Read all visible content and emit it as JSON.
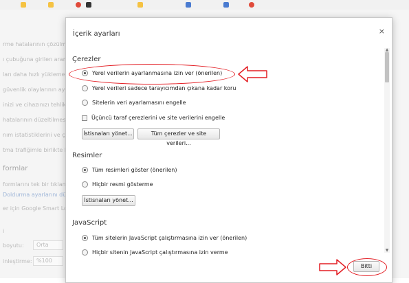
{
  "background": {
    "lines": [
      "rme hatalarının çözülme",
      "ı çubuğuna girilen aram",
      "ları daha hızlı yüklemek",
      "güvenlik olaylarının ayr",
      "inizi ve cihazınızı tehlik",
      "hatalarının düzeltilmes",
      "nım istatistiklerini ve çök",
      "tma trafiğimle birlikte b"
    ],
    "section_title": "formlar",
    "form_lines": [
      "formlarını tek bir tıklam",
      "Doldurma ayarlarını dü",
      "er için Google Smart Loc"
    ],
    "marker": "i",
    "font_label": "boyutu:",
    "font_value": "Orta",
    "zoom_label": "inleştirme:",
    "zoom_value": "%100"
  },
  "dialog": {
    "title": "İçerik ayarları",
    "close": "×",
    "cookies": {
      "heading": "Çerezler",
      "options": [
        "Yerel verilerin ayarlanmasına izin ver (önerilen)",
        "Yerel verileri sadece tarayıcımdan çıkana kadar koru",
        "Sitelerin veri ayarlamasını engelle"
      ],
      "block_third_party": "Üçüncü taraf çerezlerini ve site verilerini engelle",
      "manage_exceptions": "İstisnaları yönet...",
      "all_cookies": "Tüm çerezler ve site verileri..."
    },
    "images": {
      "heading": "Resimler",
      "options": [
        "Tüm resimleri göster (önerilen)",
        "Hiçbir resmi gösterme"
      ],
      "manage_exceptions": "İstisnaları yönet..."
    },
    "javascript": {
      "heading": "JavaScript",
      "options": [
        "Tüm sitelerin JavaScript çalıştırmasına izin ver (önerilen)",
        "Hiçbir sitenin JavaScript çalıştırmasına izin verme"
      ]
    },
    "done": "Bitti"
  },
  "colors": {
    "annotation": "#e31e24"
  }
}
